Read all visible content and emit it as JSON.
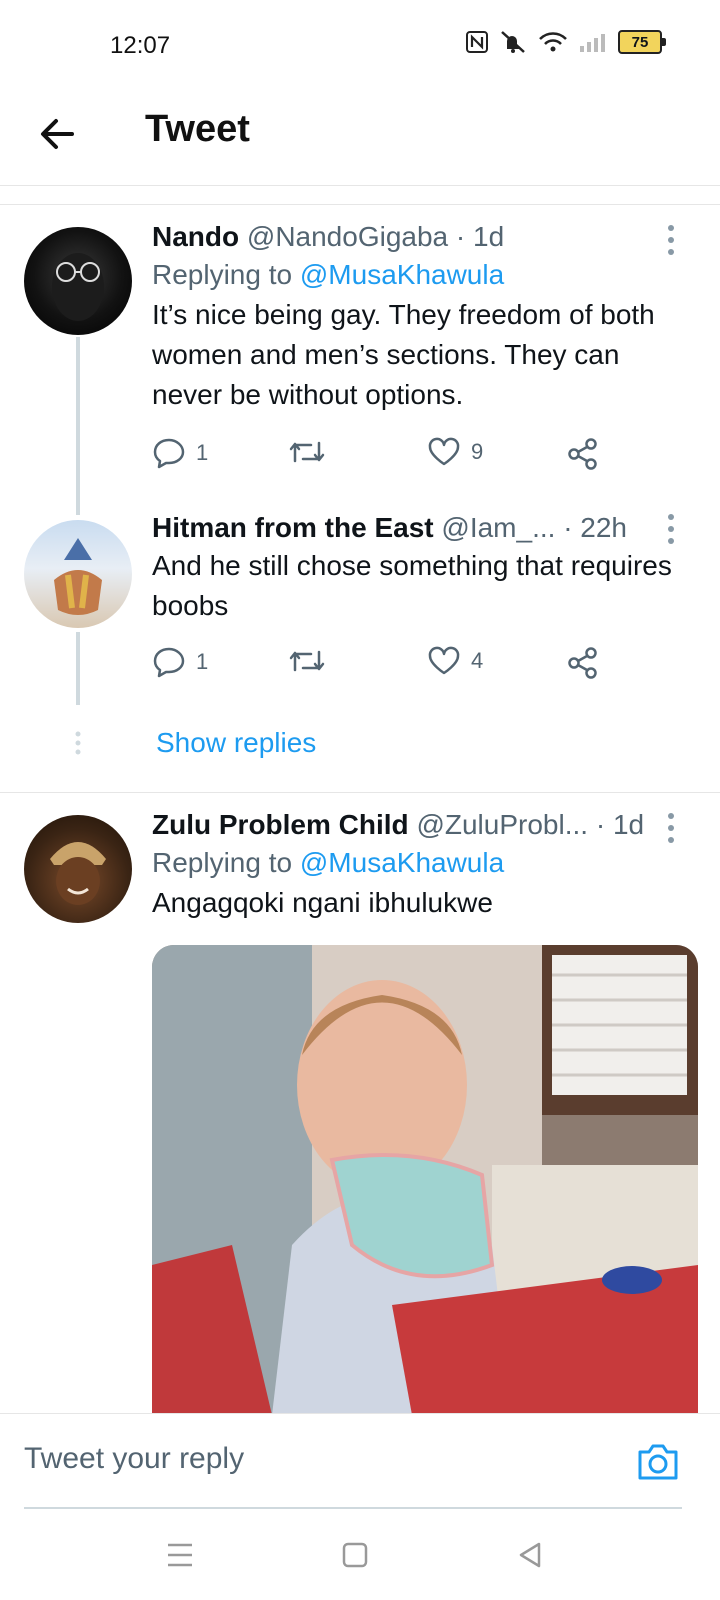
{
  "status_bar": {
    "time": "12:07",
    "battery": "75"
  },
  "header": {
    "title": "Tweet"
  },
  "tweets": [
    {
      "name": "Nando",
      "handle": "@NandoGigaba",
      "time": "· 1d",
      "replying_label": "Replying to",
      "replying_to": "@MusaKhawula",
      "text": "It’s nice being gay. They freedom of both women and men’s sections. They can never be without options.",
      "reply_count": "1",
      "like_count": "9"
    },
    {
      "name": "Hitman from the East",
      "handle": "@Iam_...",
      "time": "· 22h",
      "text": "And he still chose something that requires boobs",
      "reply_count": "1",
      "like_count": "4",
      "show_replies": "Show replies"
    },
    {
      "name": "Zulu Problem Child",
      "handle": "@ZuluProbl...",
      "time": "· 1d",
      "replying_label": "Replying to",
      "replying_to": "@MusaKhawula",
      "text": "Angagqoki ngani ibhulukwe"
    }
  ],
  "composer": {
    "placeholder": "Tweet your reply"
  },
  "icons": {
    "back": "arrow-left-icon",
    "more": "more-vertical-icon",
    "reply": "reply-bubble-icon",
    "retweet": "retweet-icon",
    "like": "heart-icon",
    "share": "share-icon",
    "camera": "camera-icon"
  },
  "colors": {
    "accent": "#1d9bf0",
    "muted": "#536471",
    "text": "#0f1419"
  }
}
